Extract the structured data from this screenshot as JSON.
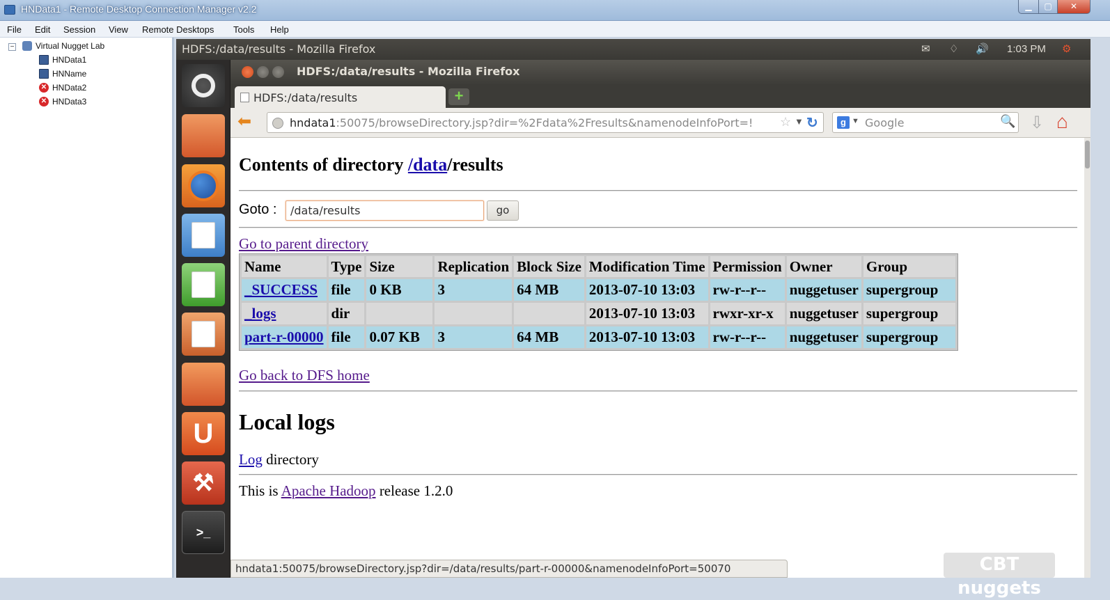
{
  "window": {
    "title": "HNData1 - Remote Desktop Connection Manager v2.2",
    "controls": [
      "minimize",
      "maximize",
      "close"
    ]
  },
  "menu": [
    "File",
    "Edit",
    "Session",
    "View",
    "Remote Desktops",
    "Tools",
    "Help"
  ],
  "tree": {
    "root": "Virtual Nugget Lab",
    "expander": "−",
    "items": [
      {
        "label": "HNData1",
        "status": "connected"
      },
      {
        "label": "HNName",
        "status": "connected"
      },
      {
        "label": "HNData2",
        "status": "error"
      },
      {
        "label": "HNData3",
        "status": "error"
      }
    ]
  },
  "ubuntu_panel": {
    "title": "HDFS:/data/results - Mozilla Firefox",
    "clock": "1:03 PM"
  },
  "firefox": {
    "window_title": "HDFS:/data/results - Mozilla Firefox",
    "tab_label": "HDFS:/data/results",
    "new_tab": "+",
    "url_host": "hndata1",
    "url_rest": ":50075/browseDirectory.jsp?dir=%2Fdata%2Fresults&namenodeInfoPort=!",
    "search_placeholder": "Google",
    "search_engine": "g",
    "status_url": "hndata1:50075/browseDirectory.jsp?dir=/data/results/part-r-00000&namenodeInfoPort=50070"
  },
  "page": {
    "heading_prefix": "Contents of directory ",
    "heading_link": "/data",
    "heading_suffix": "/results",
    "goto_label": "Goto :",
    "goto_value": "/data/results",
    "go_button": "go",
    "parent_link": "Go to parent directory",
    "table": {
      "headers": [
        "Name",
        "Type",
        "Size",
        "Replication",
        "Block Size",
        "Modification Time",
        "Permission",
        "Owner",
        "Group"
      ],
      "rows": [
        [
          "_SUCCESS",
          "file",
          "0 KB",
          "3",
          "64 MB",
          "2013-07-10 13:03",
          "rw-r--r--",
          "nuggetuser",
          "supergroup"
        ],
        [
          "_logs",
          "dir",
          "",
          "",
          "",
          "2013-07-10 13:03",
          "rwxr-xr-x",
          "nuggetuser",
          "supergroup"
        ],
        [
          "part-r-00000",
          "file",
          "0.07 KB",
          "3",
          "64 MB",
          "2013-07-10 13:03",
          "rw-r--r--",
          "nuggetuser",
          "supergroup"
        ]
      ]
    },
    "dfs_home_link": "Go back to DFS home",
    "local_logs_heading": "Local logs",
    "log_link": "Log",
    "log_suffix": " directory",
    "release_prefix": "This is ",
    "release_link": "Apache Hadoop",
    "release_suffix": " release 1.2.0"
  },
  "watermark": "CBT nuggets"
}
